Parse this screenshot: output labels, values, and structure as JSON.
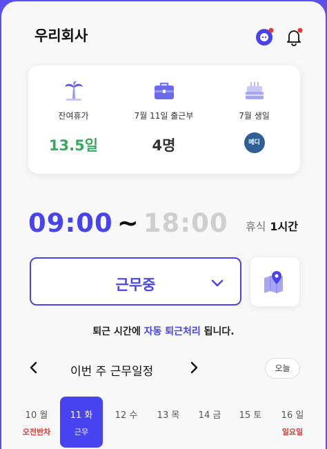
{
  "header": {
    "title": "우리회사"
  },
  "summary": [
    {
      "icon": "palm-tree-icon",
      "label": "잔여휴가",
      "value": "13.5일"
    },
    {
      "icon": "briefcase-icon",
      "label": "7월 11일 출근부",
      "value": "4명"
    },
    {
      "icon": "cake-icon",
      "label": "7월 생일",
      "avatar": "메디"
    }
  ],
  "work": {
    "start": "09:00",
    "separator": "~",
    "end": "18:00",
    "break_label": "휴식",
    "break_value": "1시간"
  },
  "status": {
    "label": "근무중"
  },
  "notice": {
    "pre": "퇴근 시간에 ",
    "highlight": "자동 퇴근처리",
    "post": " 됩니다."
  },
  "week": {
    "title": "이번 주 근무일정",
    "today_label": "오늘",
    "days": [
      {
        "label": "10 월",
        "status": "오전반차"
      },
      {
        "label": "11 화",
        "status": "근무",
        "selected": true
      },
      {
        "label": "12 수",
        "status": ""
      },
      {
        "label": "13 목",
        "status": ""
      },
      {
        "label": "14 금",
        "status": ""
      },
      {
        "label": "15 토",
        "status": ""
      },
      {
        "label": "16 일",
        "status": "일요일"
      }
    ]
  },
  "colors": {
    "accent": "#4743f0",
    "green": "#3aa75f",
    "red": "#d93a3a",
    "frame_background": "#5a4ff0"
  }
}
